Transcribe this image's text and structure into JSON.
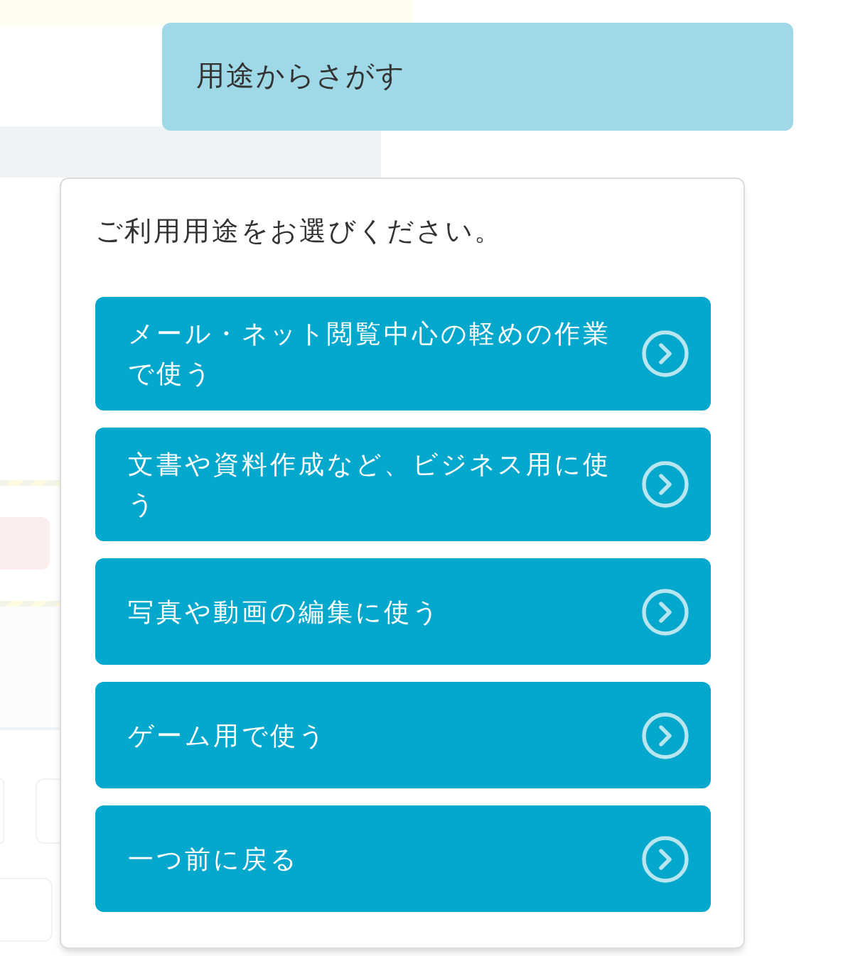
{
  "trigger": {
    "label": "用途からさがす"
  },
  "panel": {
    "prompt": "ご利用用途をお選びください。",
    "options": [
      {
        "label": "メール・ネット閲覧中心の軽めの作業で使う"
      },
      {
        "label": "文書や資料作成など、ビジネス用に使う"
      },
      {
        "label": "写真や動画の編集に使う"
      },
      {
        "label": "ゲーム用で使う"
      },
      {
        "label": "一つ前に戻る"
      }
    ]
  }
}
